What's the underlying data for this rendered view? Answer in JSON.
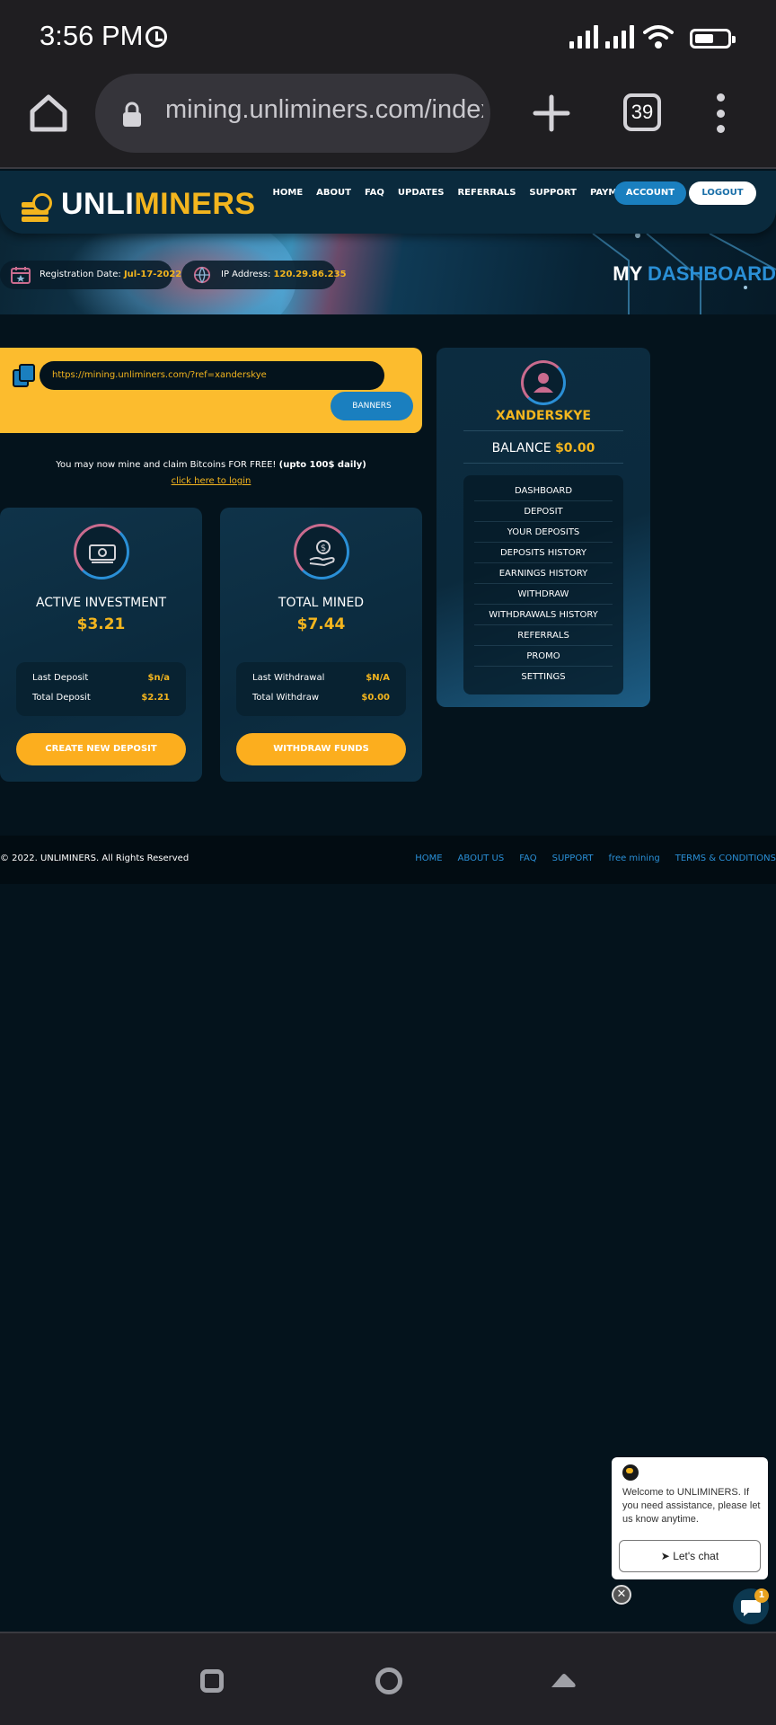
{
  "status_bar": {
    "time": "3:56 PM",
    "tab_count": "39"
  },
  "browser": {
    "url": "mining.unliminers.com/index.php?a=account"
  },
  "nav": {
    "logo_part1": "UNLI",
    "logo_part2": "MINERS",
    "links": [
      "HOME",
      "ABOUT",
      "FAQ",
      "UPDATES",
      "REFERRALS",
      "SUPPORT",
      "PAYMENTS"
    ],
    "account_label": "ACCOUNT",
    "logout_label": "LOGOUT"
  },
  "hero": {
    "reg_label": "Registration Date:",
    "reg_value": "Jul-17-2022",
    "ip_label": "IP Address:",
    "ip_value": "120.29.86.235",
    "title_white": "MY",
    "title_blue": "DASHBOARD"
  },
  "referral": {
    "link": "https://mining.unliminers.com/?ref=xanderskye",
    "banners_label": "BANNERS"
  },
  "claim": {
    "text": "You may now mine and claim Bitcoins FOR FREE!",
    "bold": "(upto 100$ daily)",
    "link": "click here to login"
  },
  "cards": [
    {
      "title": "ACTIVE INVESTMENT",
      "value": "$3.21",
      "row1_label": "Last Deposit",
      "row1_value": "$n/a",
      "row2_label": "Total Deposit",
      "row2_value": "$2.21",
      "button": "CREATE NEW DEPOSIT"
    },
    {
      "title": "TOTAL MINED",
      "value": "$7.44",
      "row1_label": "Last Withdrawal",
      "row1_value": "$N/A",
      "row2_label": "Total Withdraw",
      "row2_value": "$0.00",
      "button": "WITHDRAW FUNDS"
    }
  ],
  "sidebar": {
    "username": "XANDERSKYE",
    "balance_label": "BALANCE",
    "balance_value": "$0.00",
    "menu": [
      "DASHBOARD",
      "DEPOSIT",
      "YOUR DEPOSITS",
      "DEPOSITS HISTORY",
      "EARNINGS HISTORY",
      "WITHDRAW",
      "WITHDRAWALS HISTORY",
      "REFERRALS",
      "PROMO",
      "SETTINGS"
    ]
  },
  "footer": {
    "copyright": "© 2022. UNLIMINERS. All Rights Reserved",
    "links": [
      "HOME",
      "ABOUT US",
      "FAQ",
      "SUPPORT",
      "free mining",
      "TERMS & CONDITIONS"
    ]
  },
  "chat": {
    "message": "Welcome to UNLIMINERS. If you need assistance, please let us know anytime.",
    "button": "Let's chat",
    "badge": "1"
  },
  "colors": {
    "accent_yellow": "#fcbc2e",
    "accent_blue": "#1a7fbf",
    "background": "#04131c"
  }
}
